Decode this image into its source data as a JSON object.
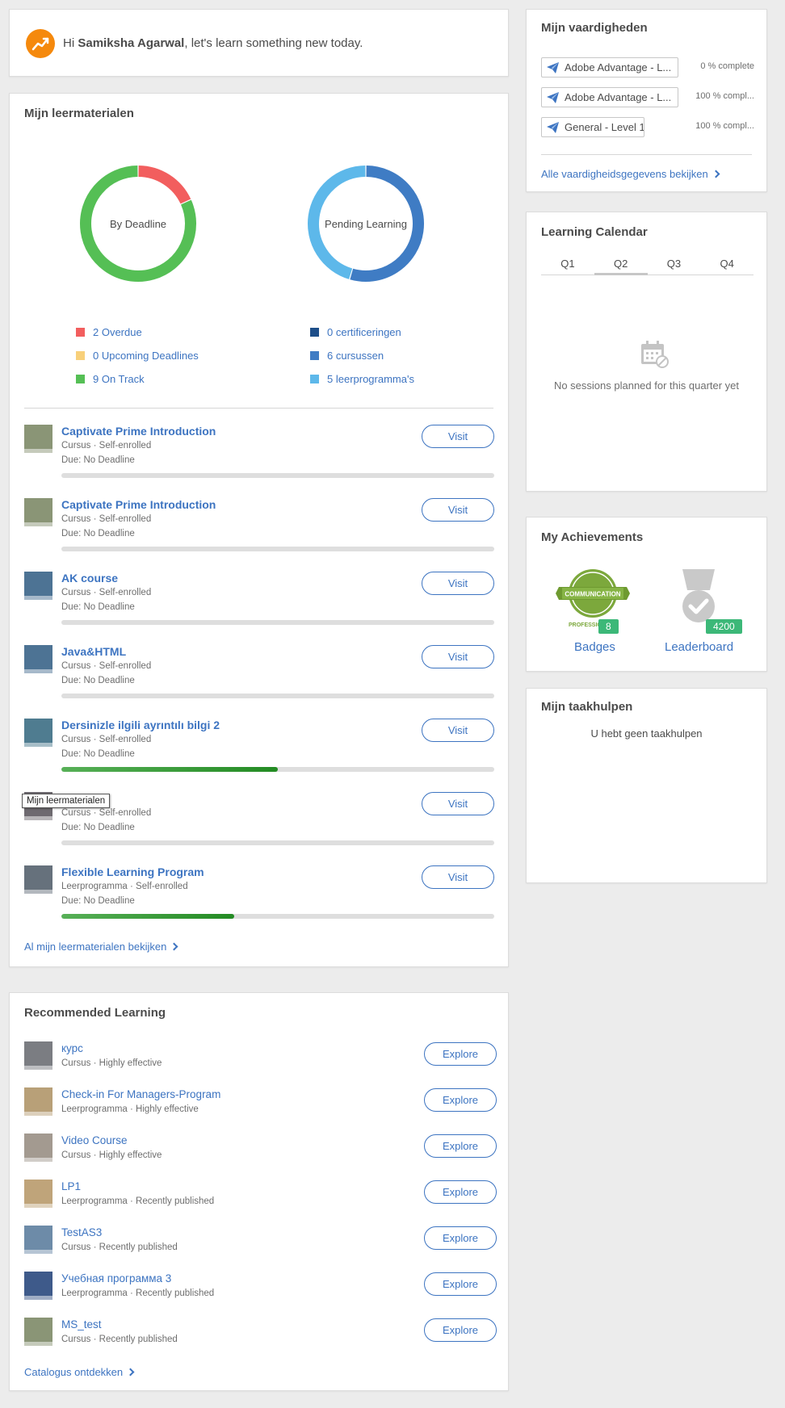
{
  "greeting": {
    "prefix": "Hi",
    "name": "Samiksha Agarwal",
    "suffix": ", let's learn something new today."
  },
  "materials": {
    "title": "Mijn leermaterialen",
    "donut_deadline": {
      "label": "By Deadline",
      "legend": [
        {
          "text": "2 Overdue",
          "color": "#f25e5e",
          "value": 2
        },
        {
          "text": "0 Upcoming Deadlines",
          "color": "#f8d07a",
          "value": 0
        },
        {
          "text": "9 On Track",
          "color": "#55bf55",
          "value": 9
        }
      ]
    },
    "donut_pending": {
      "label": "Pending Learning",
      "legend": [
        {
          "text": "0 certificeringen",
          "color": "#1d4e89",
          "value": 0
        },
        {
          "text": "6 cursussen",
          "color": "#3f7cc4",
          "value": 6
        },
        {
          "text": "5 leerprogramma's",
          "color": "#5db8ea",
          "value": 5
        }
      ]
    },
    "items": [
      {
        "title": "Captivate Prime Introduction",
        "meta": "Cursus · Self-enrolled",
        "due": "Due: No Deadline",
        "progress": 0,
        "thumb": "#8a9576",
        "button": "Visit"
      },
      {
        "title": "Captivate Prime Introduction",
        "meta": "Cursus · Self-enrolled",
        "due": "Due: No Deadline",
        "progress": 0,
        "thumb": "#8a9576",
        "button": "Visit"
      },
      {
        "title": "AK course",
        "meta": "Cursus · Self-enrolled",
        "due": "Due: No Deadline",
        "progress": 0,
        "thumb": "#4d7394",
        "button": "Visit"
      },
      {
        "title": "Java&HTML",
        "meta": "Cursus · Self-enrolled",
        "due": "Due: No Deadline",
        "progress": 0,
        "thumb": "#4d7394",
        "button": "Visit"
      },
      {
        "title": "Dersinizle ilgili ayrıntılı bilgi 2",
        "meta": "Cursus · Self-enrolled",
        "due": "Due: No Deadline",
        "progress": 0.5,
        "thumb": "#4f7c90",
        "button": "Visit"
      },
      {
        "title": "",
        "meta": "Cursus · Self-enrolled",
        "due": "Due: No Deadline",
        "progress": 0,
        "thumb": "#6e6a70",
        "button": "Visit"
      },
      {
        "title": "Flexible Learning Program",
        "meta": "Leerprogramma · Self-enrolled",
        "due": "Due: No Deadline",
        "progress": 0.4,
        "thumb": "#66717c",
        "button": "Visit"
      }
    ],
    "tooltip": "Mijn leermaterialen",
    "footer_link": "Al mijn leermaterialen bekijken"
  },
  "recommended": {
    "title": "Recommended Learning",
    "items": [
      {
        "title": "курс",
        "meta": "Cursus · Highly effective",
        "thumb": "#7b7d82",
        "button": "Explore"
      },
      {
        "title": "Check-in For Managers-Program",
        "meta": "Leerprogramma · Highly effective",
        "thumb": "#b8a078",
        "button": "Explore"
      },
      {
        "title": "Video Course",
        "meta": "Cursus · Highly effective",
        "thumb": "#a39a90",
        "button": "Explore"
      },
      {
        "title": "LP1",
        "meta": "Leerprogramma · Recently published",
        "thumb": "#bfa47a",
        "button": "Explore"
      },
      {
        "title": "TestAS3",
        "meta": "Cursus · Recently published",
        "thumb": "#6d8ba8",
        "button": "Explore"
      },
      {
        "title": "Учебная программа 3",
        "meta": "Leerprogramma · Recently published",
        "thumb": "#3e5a8a",
        "button": "Explore"
      },
      {
        "title": "MS_test",
        "meta": "Cursus · Recently published",
        "thumb": "#8a9576",
        "button": "Explore"
      }
    ],
    "footer_link": "Catalogus ontdekken"
  },
  "skills": {
    "title": "Mijn vaardigheden",
    "items": [
      {
        "name": "Adobe Advantage - L...",
        "pct": "0 % complete"
      },
      {
        "name": "Adobe Advantage - L...",
        "pct": "100 % compl..."
      },
      {
        "name": "General - Level 1",
        "pct": "100 % compl..."
      }
    ],
    "footer_link": "Alle vaardigheidsgegevens bekijken"
  },
  "calendar": {
    "title": "Learning Calendar",
    "tabs": [
      "Q1",
      "Q2",
      "Q3",
      "Q4"
    ],
    "active_tab": "Q2",
    "empty": "No sessions planned for this quarter yet"
  },
  "achievements": {
    "title": "My Achievements",
    "badges_label": "Badges",
    "badges_count": "8",
    "badge_text": "COMMUNICATION",
    "badge_sub": "PROFESSIONAL",
    "leaderboard_label": "Leaderboard",
    "leaderboard_points": "4200"
  },
  "tasks": {
    "title": "Mijn taakhulpen",
    "empty": "U hebt geen taakhulpen"
  },
  "colors": {
    "link": "#3d74c1",
    "greeting_logo": "#f5890d",
    "progress_fill": "#238b23",
    "badge_green": "#3cb878"
  }
}
